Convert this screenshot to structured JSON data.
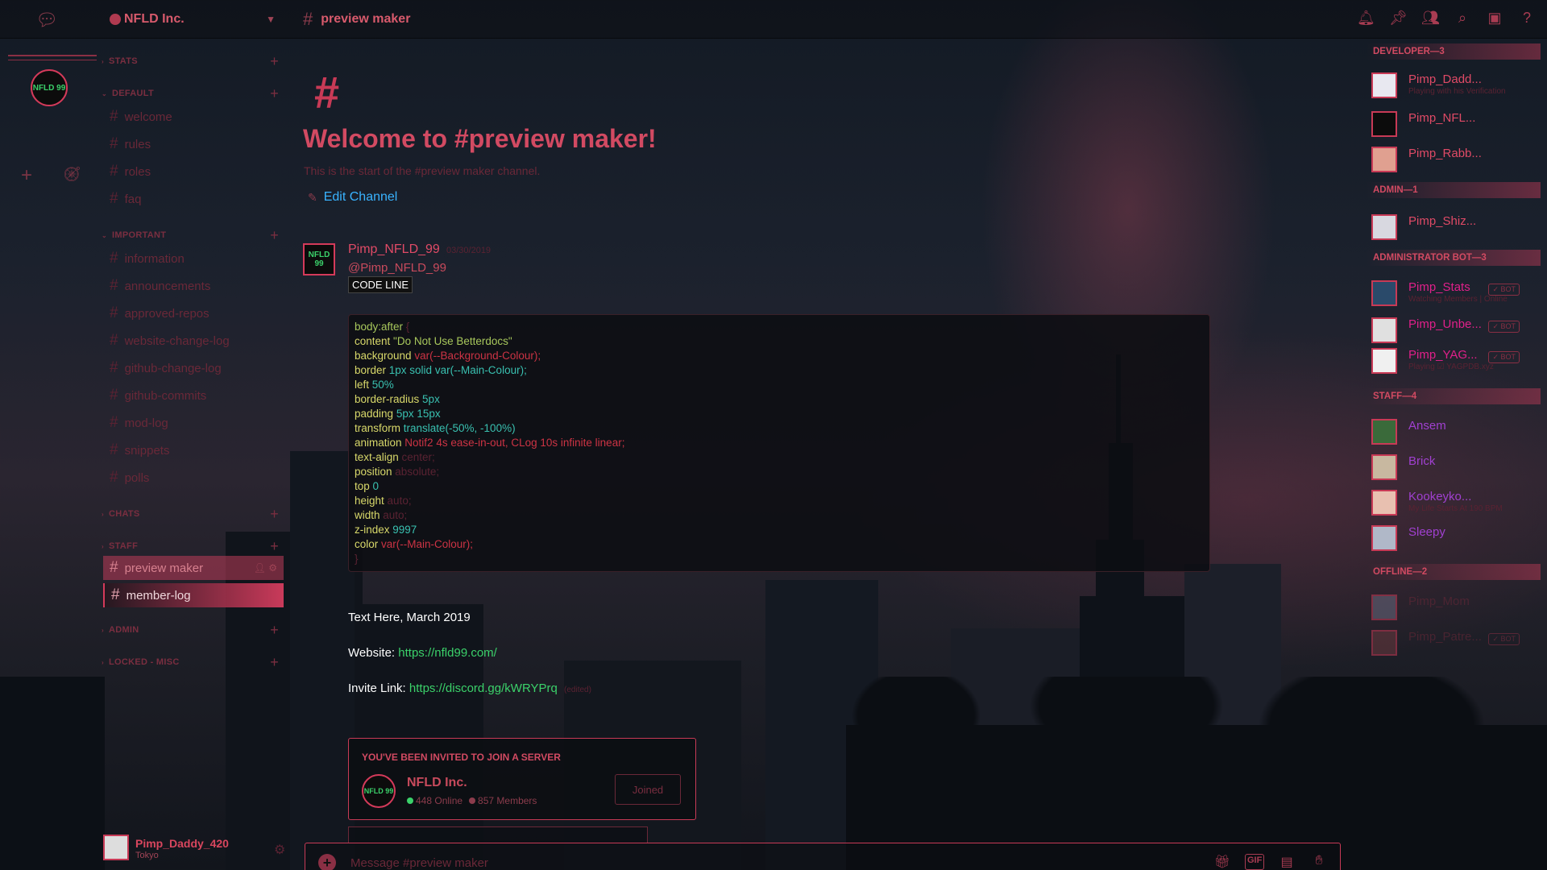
{
  "guild": {
    "name": "NFLD Inc."
  },
  "channel": {
    "name": "preview maker"
  },
  "icons": {
    "top": [
      "bell-icon",
      "pin-icon",
      "members-icon",
      "search-icon",
      "inbox-icon",
      "help-icon"
    ],
    "composer": [
      "gift-icon",
      "gif-icon",
      "sticker-icon",
      "emoji-icon"
    ]
  },
  "composer_gif": "GIF",
  "server_icon_text": "NFLD 99",
  "categories": {
    "stats": "STATS",
    "default": "DEFAULT",
    "important": "IMPORTANT",
    "chats": "CHATS",
    "staff": "STAFF",
    "admin": "ADMIN",
    "locked": "LOCKED - MISC"
  },
  "channels": {
    "welcome": "welcome",
    "rules": "rules",
    "roles": "roles",
    "faq": "faq",
    "information": "information",
    "announcements": "announcements",
    "approved_repos": "approved-repos",
    "website_change_log": "website-change-log",
    "github_change_log": "github-change-log",
    "github_commits": "github-commits",
    "mod_log": "mod-log",
    "snippets": "snippets",
    "polls": "polls",
    "preview_maker": "preview maker",
    "member_log": "member-log"
  },
  "user": {
    "name": "Pimp_Daddy_420",
    "status": "Tokyo"
  },
  "welcome": {
    "hash": "#",
    "title": "Welcome to #preview maker!",
    "subtitle": "This is the start of the #preview maker channel.",
    "edit_label": "Edit Channel"
  },
  "message": {
    "author": "Pimp_NFLD_99",
    "timestamp": "03/30/2019",
    "mention": "@Pimp_NFLD_99",
    "code_label": "CODE LINE",
    "code": [
      {
        "prop": "body:after",
        "rest": " {"
      },
      {
        "prop": "content",
        "val": " \"Do Not Use Betterdocs\""
      },
      {
        "prop": "background",
        "val": " var(--Background-Colour);"
      },
      {
        "prop": "border",
        "val": " 1px solid var(--Main-Colour);"
      },
      {
        "prop": "left",
        "val": " 50%"
      },
      {
        "prop": "border-radius",
        "val": " 5px"
      },
      {
        "prop": "padding",
        "val": " 5px 15px"
      },
      {
        "prop": "transform",
        "val": " translate(-50%, -100%)"
      },
      {
        "prop": "animation",
        "val": " Notif2 4s ease-in-out, CLog 10s infinite linear;"
      },
      {
        "prop": "text-align",
        "val": " center;"
      },
      {
        "prop": "position",
        "val": " absolute;"
      },
      {
        "prop": "top",
        "val": " 0"
      },
      {
        "prop": "height",
        "val": " auto;"
      },
      {
        "prop": "width",
        "val": " auto;"
      },
      {
        "prop": "z-index",
        "val": " 9997"
      },
      {
        "prop": "color",
        "val": " var(--Main-Colour);"
      },
      {
        "prop": "}",
        "val": ""
      }
    ],
    "text": "Text Here, March 2019",
    "website_label": "Website:",
    "website_url": "https://nfld99.com/",
    "invite_label": "Invite Link:",
    "invite_url": "https://discord.gg/kWRYPrq",
    "edited": "(edited)"
  },
  "invite": {
    "header": "YOU'VE BEEN INVITED TO JOIN A SERVER",
    "server": "NFLD Inc.",
    "online": "448 Online",
    "members": "857 Members",
    "button": "Joined"
  },
  "composer": {
    "placeholder": "Message #preview maker"
  },
  "members": {
    "groups": {
      "developer": "DEVELOPER—3",
      "admin": "ADMIN—1",
      "admin_bot": "ADMINISTRATOR BOT—3",
      "staff": "STAFF—4",
      "offline": "OFFLINE—2"
    },
    "bot_tag": "✓ BOT",
    "list": [
      {
        "name": "Pimp_Dadd...",
        "status": "Playing with his Verification"
      },
      {
        "name": "Pimp_NFL...",
        "status": ""
      },
      {
        "name": "Pimp_Rabb...",
        "status": ""
      },
      {
        "name": "Pimp_Shiz...",
        "status": ""
      },
      {
        "name": "Pimp_Stats",
        "status": "Watching Members | Online"
      },
      {
        "name": "Pimp_Unbe...",
        "status": ""
      },
      {
        "name": "Pimp_YAG...",
        "status": "Playing ☑ YAGPDB.xyz"
      },
      {
        "name": "Ansem",
        "status": ""
      },
      {
        "name": "Brick",
        "status": ""
      },
      {
        "name": "Kookeyko...",
        "status": "My Life Starts At 190 BPM"
      },
      {
        "name": "Sleepy",
        "status": ""
      },
      {
        "name": "Pimp_Mom",
        "status": ""
      },
      {
        "name": "Pimp_Patre...",
        "status": ""
      }
    ]
  }
}
